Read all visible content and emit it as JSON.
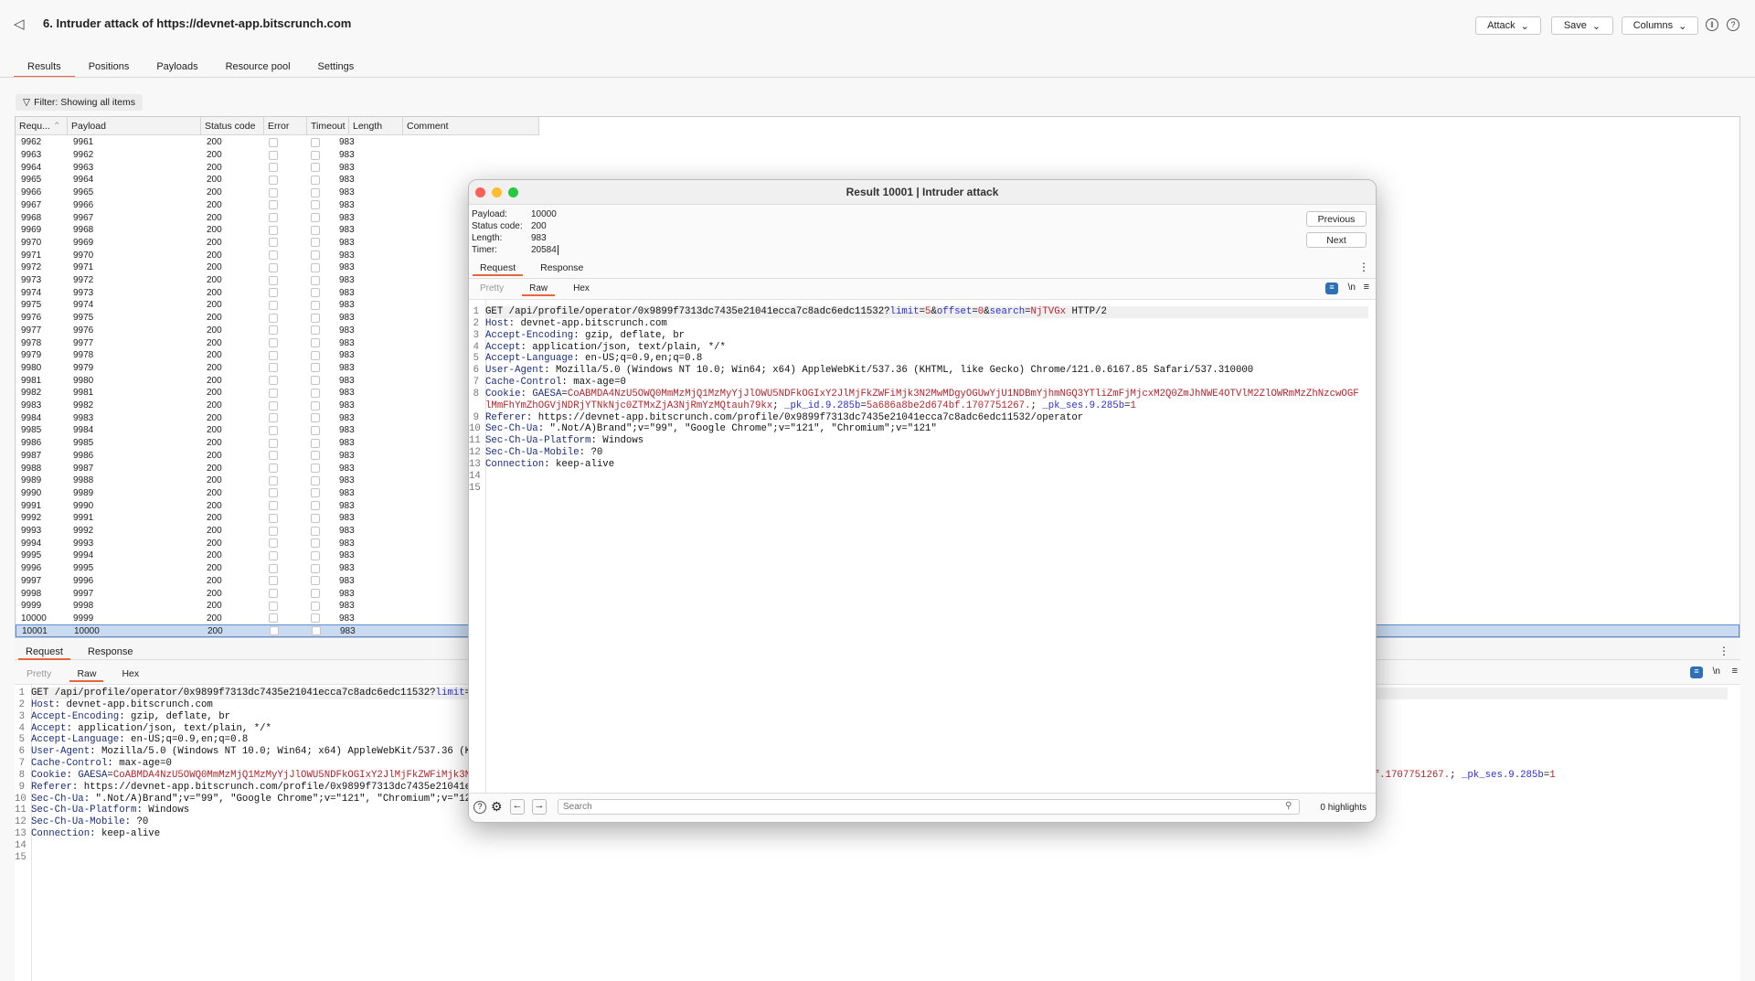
{
  "header": {
    "title": "6. Intruder attack of https://devnet-app.bitscrunch.com",
    "attack": "Attack",
    "save": "Save",
    "columns": "Columns"
  },
  "tabs": [
    "Results",
    "Positions",
    "Payloads",
    "Resource pool",
    "Settings"
  ],
  "filter": "Filter: Showing all items",
  "table": {
    "columns": [
      "Requ...",
      "Payload",
      "Status code",
      "Error",
      "Timeout",
      "Length",
      "Comment"
    ],
    "rows": [
      [
        "9962",
        "9961"
      ],
      [
        "9963",
        "9962"
      ],
      [
        "9964",
        "9963"
      ],
      [
        "9965",
        "9964"
      ],
      [
        "9966",
        "9965"
      ],
      [
        "9967",
        "9966"
      ],
      [
        "9968",
        "9967"
      ],
      [
        "9969",
        "9968"
      ],
      [
        "9970",
        "9969"
      ],
      [
        "9971",
        "9970"
      ],
      [
        "9972",
        "9971"
      ],
      [
        "9973",
        "9972"
      ],
      [
        "9974",
        "9973"
      ],
      [
        "9975",
        "9974"
      ],
      [
        "9976",
        "9975"
      ],
      [
        "9977",
        "9976"
      ],
      [
        "9978",
        "9977"
      ],
      [
        "9979",
        "9978"
      ],
      [
        "9980",
        "9979"
      ],
      [
        "9981",
        "9980"
      ],
      [
        "9982",
        "9981"
      ],
      [
        "9983",
        "9982"
      ],
      [
        "9984",
        "9983"
      ],
      [
        "9985",
        "9984"
      ],
      [
        "9986",
        "9985"
      ],
      [
        "9987",
        "9986"
      ],
      [
        "9988",
        "9987"
      ],
      [
        "9989",
        "9988"
      ],
      [
        "9990",
        "9989"
      ],
      [
        "9991",
        "9990"
      ],
      [
        "9992",
        "9991"
      ],
      [
        "9993",
        "9992"
      ],
      [
        "9994",
        "9993"
      ],
      [
        "9995",
        "9994"
      ],
      [
        "9996",
        "9995"
      ],
      [
        "9997",
        "9996"
      ],
      [
        "9998",
        "9997"
      ],
      [
        "9999",
        "9998"
      ],
      [
        "10000",
        "9999"
      ],
      [
        "10001",
        "10000"
      ]
    ],
    "status": "200",
    "length": "983",
    "selected_request": "10001"
  },
  "panes": {
    "request": "Request",
    "response": "Response",
    "pretty": "Pretty",
    "raw": "Raw",
    "hex": "Hex",
    "newline": "\\n"
  },
  "request_lines": [
    [
      [
        "GET /api/profile/operator/0x9899f7313dc7435e21041ecca7c8adc6edc11532?",
        "v"
      ],
      [
        "limit",
        "pn"
      ],
      [
        "=",
        "v"
      ],
      [
        "5",
        "pv"
      ],
      [
        "&",
        "v"
      ],
      [
        "offset",
        "pn"
      ],
      [
        "=",
        "v"
      ],
      [
        "0",
        "pv"
      ],
      [
        "&",
        "v"
      ],
      [
        "search",
        "pn"
      ],
      [
        "=",
        "v"
      ],
      [
        "NjTVGx",
        "pv"
      ],
      [
        " HTTP/2",
        "v"
      ]
    ],
    [
      [
        "Host",
        "k"
      ],
      [
        ": devnet-app.bitscrunch.com",
        "v"
      ]
    ],
    [
      [
        "Accept-Encoding",
        "k"
      ],
      [
        ": gzip, deflate, br",
        "v"
      ]
    ],
    [
      [
        "Accept",
        "k"
      ],
      [
        ": application/json, text/plain, */*",
        "v"
      ]
    ],
    [
      [
        "Accept-Language",
        "k"
      ],
      [
        ": en-US;q=0.9,en;q=0.8",
        "v"
      ]
    ],
    [
      [
        "User-Agent",
        "k"
      ],
      [
        ": Mozilla/5.0 (Windows NT 10.0; Win64; x64) AppleWebKit/537.36 (KHTML, like Gecko) Chrome/121.0.6167.85 Safari/537.310000",
        "v"
      ]
    ],
    [
      [
        "Cache-Control",
        "k"
      ],
      [
        ": max-age=0",
        "v"
      ]
    ],
    [
      [
        "Cookie",
        "k"
      ],
      [
        ": ",
        "v"
      ],
      [
        "GAESA",
        "k"
      ],
      [
        "=",
        "v"
      ],
      [
        "CoABMDA4NzU5OWQ0MmMzMjQ1MzMyYjJlOWU5NDFkOGIxY2JlMjFkZWFiMjk3N2MwMDgyOGUwYjU1NDBmYjhmNGQ3YTliZmFjMjcxM2Q0ZmJhNWE4OTVlM2ZlOWRmMzZhNzcwOGFlMmFhYmZhOGVjNDRjYTNkNjc0ZTMxZjA3NjRmYzMQtauh79kx",
        "ck"
      ],
      [
        "; ",
        "v"
      ],
      [
        "_pk_id.9.285b",
        "pn"
      ],
      [
        "=",
        "v"
      ],
      [
        "5a686a8be2d674bf.1707751267.",
        "ck"
      ],
      [
        "; ",
        "v"
      ],
      [
        "_pk_ses.9.285b",
        "pn"
      ],
      [
        "=",
        "v"
      ],
      [
        "1",
        "ck"
      ]
    ],
    [
      [
        "Referer",
        "k"
      ],
      [
        ": https://devnet-app.bitscrunch.com/profile/0x9899f7313dc7435e21041ecca7c8adc6edc11532/operator",
        "v"
      ]
    ],
    [
      [
        "Sec-Ch-Ua",
        "k"
      ],
      [
        ": \".Not/A)Brand\";v=\"99\", \"Google Chrome\";v=\"121\", \"Chromium\";v=\"121\"",
        "v"
      ]
    ],
    [
      [
        "Sec-Ch-Ua-Platform",
        "k"
      ],
      [
        ": Windows",
        "v"
      ]
    ],
    [
      [
        "Sec-Ch-Ua-Mobile",
        "k"
      ],
      [
        ": ?0",
        "v"
      ]
    ],
    [
      [
        "Connection",
        "k"
      ],
      [
        ": keep-alive",
        "v"
      ]
    ],
    [],
    []
  ],
  "modal": {
    "title": "Result 10001 | Intruder attack",
    "info": [
      [
        "Payload:",
        "10000"
      ],
      [
        "Status code:",
        "200"
      ],
      [
        "Length:",
        "983"
      ],
      [
        "Timer:",
        "20584"
      ]
    ],
    "previous": "Previous",
    "next": "Next",
    "search_placeholder": "Search",
    "highlights": "0 highlights"
  },
  "colors": {
    "accent": "#e8663d",
    "selected_row": "#c9daf1"
  }
}
